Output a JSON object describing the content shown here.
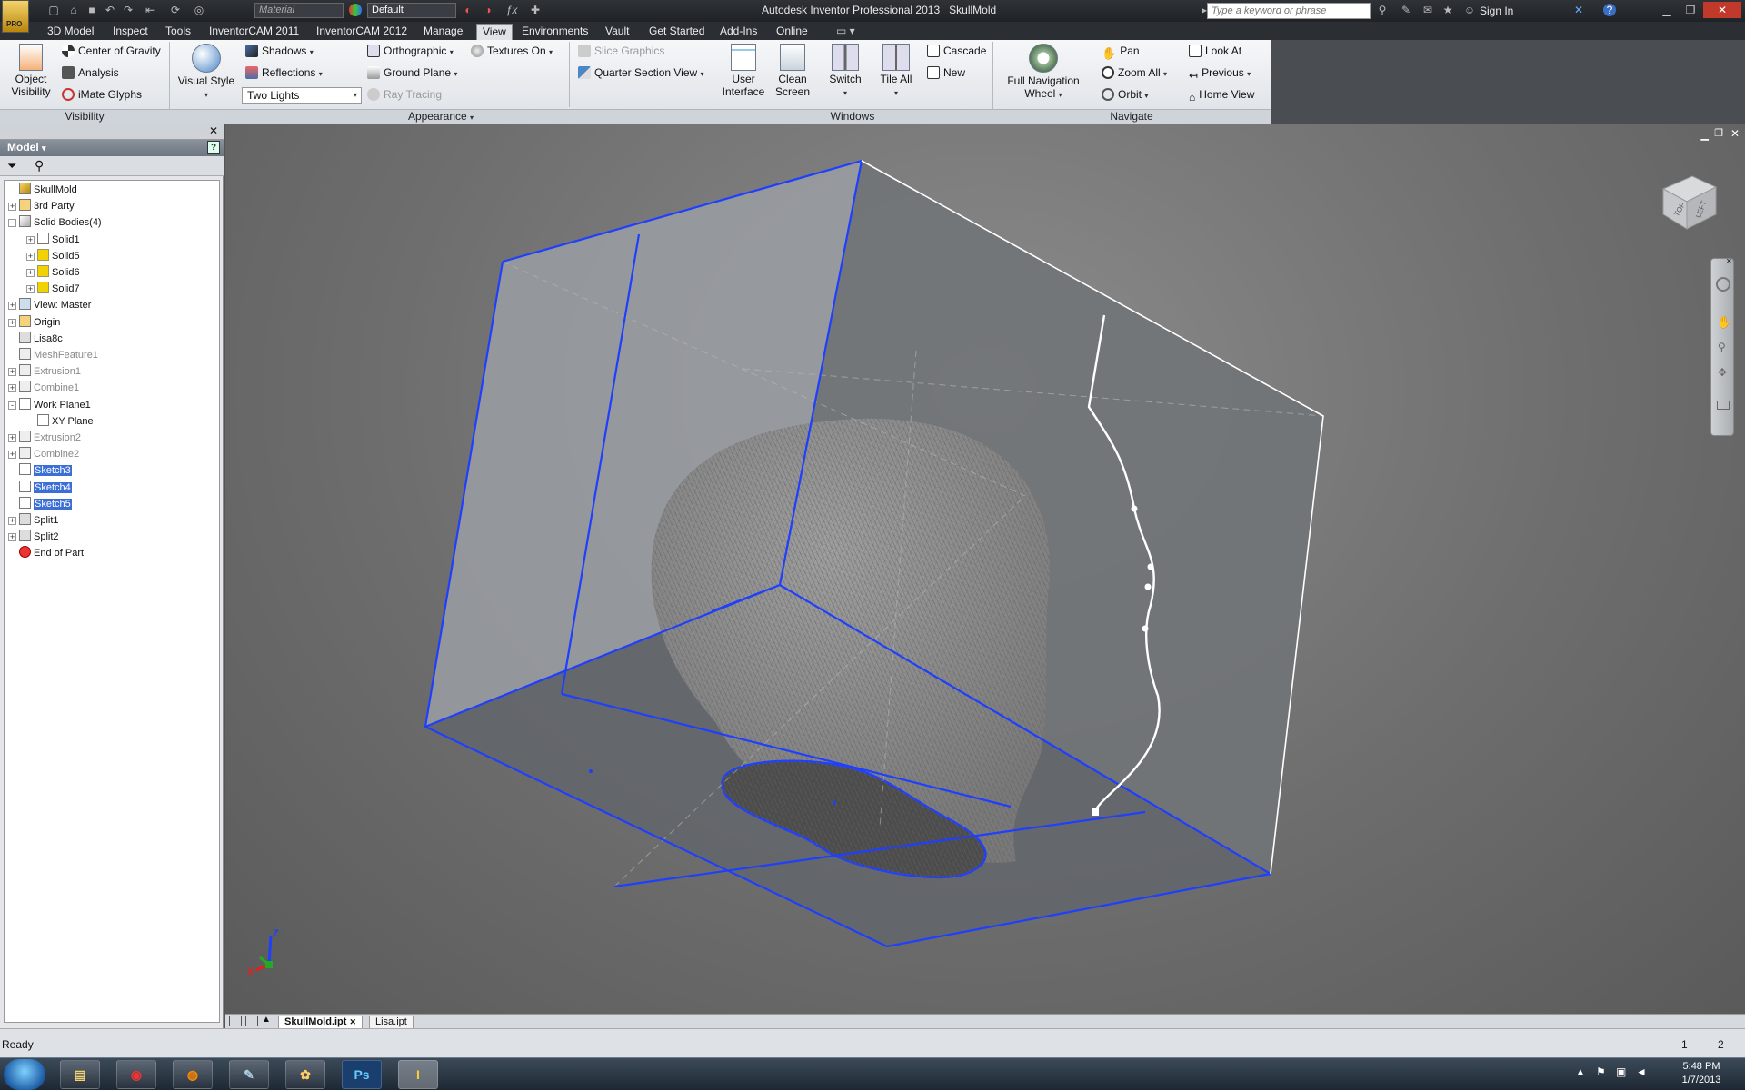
{
  "app": {
    "title": "Autodesk Inventor Professional 2013",
    "document": "SkullMold"
  },
  "quick_access": {
    "material": "Material",
    "appearance": "Default",
    "badge": "PRO"
  },
  "search": {
    "placeholder": "Type a keyword or phrase"
  },
  "sign_in": "Sign In",
  "tabs": [
    "3D Model",
    "Inspect",
    "Tools",
    "InventorCAM 2011",
    "InventorCAM 2012",
    "Manage",
    "View",
    "Environments",
    "Vault",
    "Get Started",
    "Add-Ins",
    "Online"
  ],
  "active_tab": "View",
  "ribbon": {
    "visibility": {
      "object_visibility": "Object\nVisibility",
      "center_of_gravity": "Center of Gravity",
      "analysis": "Analysis",
      "imate_glyphs": "iMate Glyphs",
      "footer": "Visibility"
    },
    "appearance": {
      "visual_style": "Visual Style",
      "shadows": "Shadows",
      "reflections": "Reflections",
      "lighting": "Two Lights",
      "orthographic": "Orthographic",
      "ground_plane": "Ground Plane",
      "ray_tracing": "Ray Tracing",
      "textures_on": "Textures On",
      "slice_graphics": "Slice Graphics",
      "quarter_section": "Quarter Section View",
      "footer": "Appearance"
    },
    "windows": {
      "user_interface": "User\nInterface",
      "clean_screen": "Clean\nScreen",
      "switch": "Switch",
      "tile_all": "Tile All",
      "cascade": "Cascade",
      "new": "New",
      "footer": "Windows"
    },
    "navigate": {
      "full_nav_wheel": "Full Navigation\nWheel",
      "pan": "Pan",
      "zoom_all": "Zoom All",
      "orbit": "Orbit",
      "look_at": "Look At",
      "previous": "Previous",
      "home_view": "Home View",
      "footer": "Navigate"
    }
  },
  "browser": {
    "title": "Model",
    "tree": [
      {
        "label": "SkullMold",
        "depth": 0,
        "exp": "",
        "icon": "part",
        "state": "normal"
      },
      {
        "label": "3rd Party",
        "depth": 0,
        "exp": "+",
        "icon": "folder",
        "state": "normal"
      },
      {
        "label": "Solid Bodies(4)",
        "depth": 0,
        "exp": "-",
        "icon": "bodies",
        "state": "normal"
      },
      {
        "label": "Solid1",
        "depth": 1,
        "exp": "+",
        "icon": "solid-white",
        "state": "normal"
      },
      {
        "label": "Solid5",
        "depth": 1,
        "exp": "+",
        "icon": "solid",
        "state": "normal"
      },
      {
        "label": "Solid6",
        "depth": 1,
        "exp": "+",
        "icon": "solid",
        "state": "normal"
      },
      {
        "label": "Solid7",
        "depth": 1,
        "exp": "+",
        "icon": "solid",
        "state": "normal"
      },
      {
        "label": "View: Master",
        "depth": 0,
        "exp": "+",
        "icon": "view",
        "state": "normal"
      },
      {
        "label": "Origin",
        "depth": 0,
        "exp": "+",
        "icon": "folder",
        "state": "normal"
      },
      {
        "label": "Lisa8c",
        "depth": 0,
        "exp": "",
        "icon": "mesh",
        "state": "normal"
      },
      {
        "label": "MeshFeature1",
        "depth": 0,
        "exp": "",
        "icon": "feature",
        "state": "gray"
      },
      {
        "label": "Extrusion1",
        "depth": 0,
        "exp": "+",
        "icon": "feature",
        "state": "gray"
      },
      {
        "label": "Combine1",
        "depth": 0,
        "exp": "+",
        "icon": "feature",
        "state": "gray"
      },
      {
        "label": "Work Plane1",
        "depth": 0,
        "exp": "-",
        "icon": "plane",
        "state": "normal"
      },
      {
        "label": "XY Plane",
        "depth": 1,
        "exp": "",
        "icon": "plane",
        "state": "normal"
      },
      {
        "label": "Extrusion2",
        "depth": 0,
        "exp": "+",
        "icon": "feature",
        "state": "gray"
      },
      {
        "label": "Combine2",
        "depth": 0,
        "exp": "+",
        "icon": "feature",
        "state": "gray"
      },
      {
        "label": "Sketch3",
        "depth": 0,
        "exp": "",
        "icon": "sketch",
        "state": "selected"
      },
      {
        "label": "Sketch4",
        "depth": 0,
        "exp": "",
        "icon": "sketch",
        "state": "selected"
      },
      {
        "label": "Sketch5",
        "depth": 0,
        "exp": "",
        "icon": "sketch",
        "state": "selected"
      },
      {
        "label": "Split1",
        "depth": 0,
        "exp": "+",
        "icon": "split",
        "state": "normal"
      },
      {
        "label": "Split2",
        "depth": 0,
        "exp": "+",
        "icon": "split",
        "state": "normal"
      },
      {
        "label": "End of Part",
        "depth": 0,
        "exp": "",
        "icon": "end",
        "state": "normal"
      }
    ]
  },
  "viewcube": {
    "faces": [
      "TOP",
      "LEFT"
    ]
  },
  "triad": {
    "x": "X",
    "y": "Y",
    "z": "Z"
  },
  "document_tabs": [
    "SkullMold.ipt",
    "Lisa.ipt"
  ],
  "status": {
    "text": "Ready",
    "page_a": "1",
    "page_b": "2"
  },
  "clock": {
    "time": "5:48 PM",
    "date": "1/7/2013"
  },
  "taskbar": [
    "start",
    "explorer",
    "chrome",
    "firefox",
    "notepad",
    "paint",
    "photoshop",
    "inventor"
  ],
  "colors": {
    "selection_blue": "#1f3fff",
    "sketch_white": "#ffffff",
    "ribbon_bg": "#e6e9ed"
  }
}
